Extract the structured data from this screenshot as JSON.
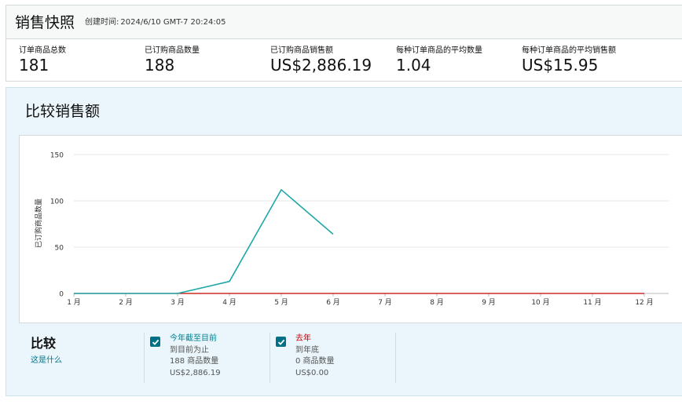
{
  "snapshot": {
    "title": "销售快照",
    "time_label": "创建时间:",
    "time_value": "2024/6/10 GMT-7 20:24:05",
    "metrics": [
      {
        "label": "订单商品总数",
        "value": "181"
      },
      {
        "label": "已订购商品数量",
        "value": "188"
      },
      {
        "label": "已订购商品销售额",
        "value": "US$2,886.19"
      },
      {
        "label": "每种订单商品的平均数量",
        "value": "1.04"
      },
      {
        "label": "每种订单商品的平均销售额",
        "value": "US$15.95"
      }
    ]
  },
  "compare": {
    "title": "比较销售额",
    "legend_title": "比较",
    "legend_link": "这是什么",
    "series": [
      {
        "name": "今年截至目前",
        "sub": "到目前为止",
        "count": "188 商品数量",
        "amount": "US$2,886.19",
        "color": "#008296",
        "checked": true
      },
      {
        "name": "去年",
        "sub": "到年底",
        "count": "0 商品数量",
        "amount": "US$0.00",
        "color": "#c40000",
        "checked": true
      }
    ]
  },
  "chart_data": {
    "type": "line",
    "ylabel": "已订购商品数量",
    "xlabel": "",
    "categories": [
      "1 月",
      "2 月",
      "3 月",
      "4 月",
      "5 月",
      "6 月",
      "7 月",
      "8 月",
      "9 月",
      "10 月",
      "11 月",
      "12 月"
    ],
    "yticks": [
      0,
      50,
      100,
      150
    ],
    "ylim": [
      0,
      150
    ],
    "grid": true,
    "series": [
      {
        "name": "今年截至目前",
        "color": "#20a8a8",
        "values": [
          0,
          0,
          0,
          13,
          112,
          64
        ]
      },
      {
        "name": "去年",
        "color": "#c40000",
        "values": [
          0,
          0,
          0,
          0,
          0,
          0,
          0,
          0,
          0,
          0,
          0,
          0
        ]
      }
    ]
  }
}
